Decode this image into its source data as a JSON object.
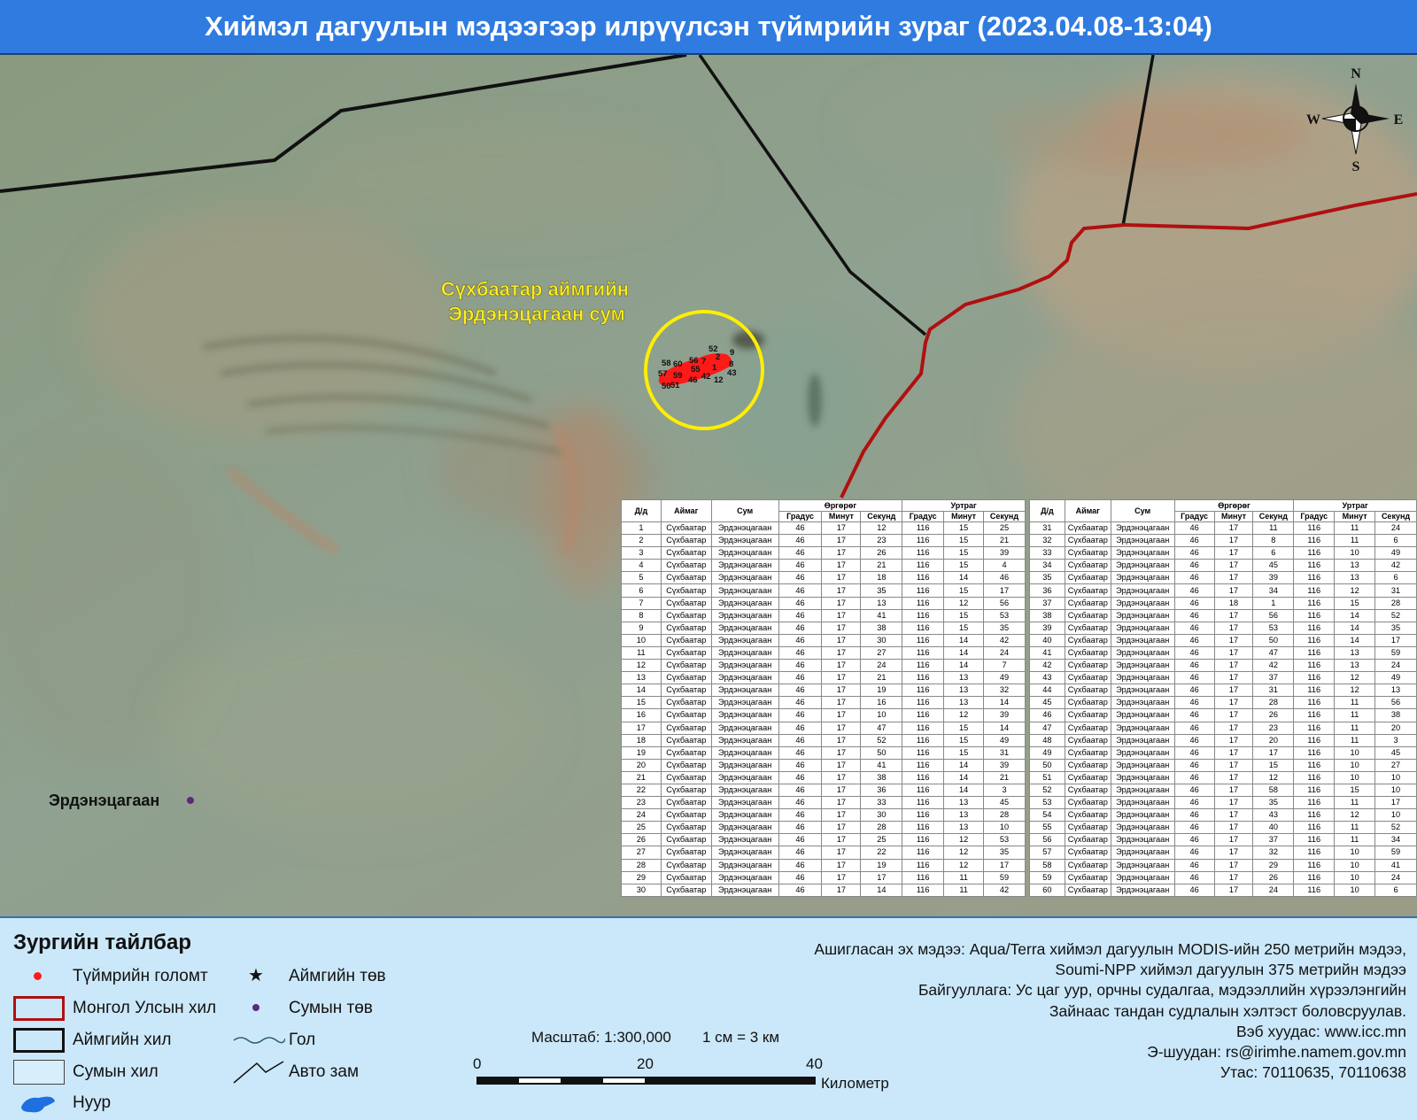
{
  "title": "Хиймэл дагуулын мэдээгээр илрүүлсэн түймрийн зураг (2023.04.08-13:04)",
  "map": {
    "region_label_line1": "Сүхбаатар аймгийн",
    "region_label_line2": "Эрдэнэцагаан сум",
    "settlement_label": "Эрдэнэцагаан",
    "compass": {
      "n": "N",
      "s": "S",
      "e": "E",
      "w": "W"
    },
    "fire_labels": [
      "52",
      "9",
      "58",
      "60",
      "56",
      "2",
      "7",
      "8",
      "57",
      "59",
      "55",
      "1",
      "43",
      "50",
      "51",
      "46",
      "42",
      "12"
    ],
    "colors": {
      "aimag_border": "#111111",
      "national_border": "#b01010",
      "fire": "#ff1a1a",
      "highlight_circle": "#ffee00"
    }
  },
  "table": {
    "headers": {
      "no": "Д/д",
      "aimag": "Аймаг",
      "sum": "Сум",
      "lat": "Өргөрөг",
      "lon": "Уртраг",
      "deg": "Градус",
      "min": "Минут",
      "sec": "Секунд"
    },
    "aimag": "Сүхбаатар",
    "sum": "Эрдэнэцагаан",
    "rows": [
      [
        1,
        46,
        17,
        12,
        116,
        15,
        25
      ],
      [
        2,
        46,
        17,
        23,
        116,
        15,
        21
      ],
      [
        3,
        46,
        17,
        26,
        116,
        15,
        39
      ],
      [
        4,
        46,
        17,
        21,
        116,
        15,
        4
      ],
      [
        5,
        46,
        17,
        18,
        116,
        14,
        46
      ],
      [
        6,
        46,
        17,
        35,
        116,
        15,
        17
      ],
      [
        7,
        46,
        17,
        13,
        116,
        12,
        56
      ],
      [
        8,
        46,
        17,
        41,
        116,
        15,
        53
      ],
      [
        9,
        46,
        17,
        38,
        116,
        15,
        35
      ],
      [
        10,
        46,
        17,
        30,
        116,
        14,
        42
      ],
      [
        11,
        46,
        17,
        27,
        116,
        14,
        24
      ],
      [
        12,
        46,
        17,
        24,
        116,
        14,
        7
      ],
      [
        13,
        46,
        17,
        21,
        116,
        13,
        49
      ],
      [
        14,
        46,
        17,
        19,
        116,
        13,
        32
      ],
      [
        15,
        46,
        17,
        16,
        116,
        13,
        14
      ],
      [
        16,
        46,
        17,
        10,
        116,
        12,
        39
      ],
      [
        17,
        46,
        17,
        47,
        116,
        15,
        14
      ],
      [
        18,
        46,
        17,
        52,
        116,
        15,
        49
      ],
      [
        19,
        46,
        17,
        50,
        116,
        15,
        31
      ],
      [
        20,
        46,
        17,
        41,
        116,
        14,
        39
      ],
      [
        21,
        46,
        17,
        38,
        116,
        14,
        21
      ],
      [
        22,
        46,
        17,
        36,
        116,
        14,
        3
      ],
      [
        23,
        46,
        17,
        33,
        116,
        13,
        45
      ],
      [
        24,
        46,
        17,
        30,
        116,
        13,
        28
      ],
      [
        25,
        46,
        17,
        28,
        116,
        13,
        10
      ],
      [
        26,
        46,
        17,
        25,
        116,
        12,
        53
      ],
      [
        27,
        46,
        17,
        22,
        116,
        12,
        35
      ],
      [
        28,
        46,
        17,
        19,
        116,
        12,
        17
      ],
      [
        29,
        46,
        17,
        17,
        116,
        11,
        59
      ],
      [
        30,
        46,
        17,
        14,
        116,
        11,
        42
      ],
      [
        31,
        46,
        17,
        11,
        116,
        11,
        24
      ],
      [
        32,
        46,
        17,
        8,
        116,
        11,
        6
      ],
      [
        33,
        46,
        17,
        6,
        116,
        10,
        49
      ],
      [
        34,
        46,
        17,
        45,
        116,
        13,
        42
      ],
      [
        35,
        46,
        17,
        39,
        116,
        13,
        6
      ],
      [
        36,
        46,
        17,
        34,
        116,
        12,
        31
      ],
      [
        37,
        46,
        18,
        1,
        116,
        15,
        28
      ],
      [
        38,
        46,
        17,
        56,
        116,
        14,
        52
      ],
      [
        39,
        46,
        17,
        53,
        116,
        14,
        35
      ],
      [
        40,
        46,
        17,
        50,
        116,
        14,
        17
      ],
      [
        41,
        46,
        17,
        47,
        116,
        13,
        59
      ],
      [
        42,
        46,
        17,
        42,
        116,
        13,
        24
      ],
      [
        43,
        46,
        17,
        37,
        116,
        12,
        49
      ],
      [
        44,
        46,
        17,
        31,
        116,
        12,
        13
      ],
      [
        45,
        46,
        17,
        28,
        116,
        11,
        56
      ],
      [
        46,
        46,
        17,
        26,
        116,
        11,
        38
      ],
      [
        47,
        46,
        17,
        23,
        116,
        11,
        20
      ],
      [
        48,
        46,
        17,
        20,
        116,
        11,
        3
      ],
      [
        49,
        46,
        17,
        17,
        116,
        10,
        45
      ],
      [
        50,
        46,
        17,
        15,
        116,
        10,
        27
      ],
      [
        51,
        46,
        17,
        12,
        116,
        10,
        10
      ],
      [
        52,
        46,
        17,
        58,
        116,
        15,
        10
      ],
      [
        53,
        46,
        17,
        35,
        116,
        11,
        17
      ],
      [
        54,
        46,
        17,
        43,
        116,
        12,
        10
      ],
      [
        55,
        46,
        17,
        40,
        116,
        11,
        52
      ],
      [
        56,
        46,
        17,
        37,
        116,
        11,
        34
      ],
      [
        57,
        46,
        17,
        32,
        116,
        10,
        59
      ],
      [
        58,
        46,
        17,
        29,
        116,
        10,
        41
      ],
      [
        59,
        46,
        17,
        26,
        116,
        10,
        24
      ],
      [
        60,
        46,
        17,
        24,
        116,
        10,
        6
      ]
    ]
  },
  "legend": {
    "title": "Зургийн тайлбар",
    "fire": "Түймрийн голомт",
    "national_border": "Монгол Улсын хил",
    "aimag_border": "Аймгийн хил",
    "sum_border": "Сумын хил",
    "lake": "Нуур",
    "aimag_center": "Аймгийн төв",
    "sum_center": "Сумын төв",
    "river": "Гол",
    "road": "Авто зам"
  },
  "scale": {
    "label": "Масштаб: 1:300,000",
    "cm": "1 см = 3 км",
    "ticks": [
      "0",
      "20",
      "40"
    ],
    "unit": "Километр"
  },
  "credits": [
    "Ашигласан эх мэдээ: Aqua/Terra хиймэл дагуулын MODIS-ийн 250 метрийн мэдээ,",
    "Soumi-NPP хиймэл дагуулын 375 метрийн мэдээ",
    "Байгууллага: Ус цаг уур, орчны судалгаа, мэдээллийн хүрээлэнгийн",
    "Зайнаас тандан судлалын хэлтэст боловсруулав.",
    "Вэб хуудас: www.icc.mn",
    "Э-шуудан: rs@irimhe.namem.gov.mn",
    "Утас: 70110635, 70110638"
  ]
}
